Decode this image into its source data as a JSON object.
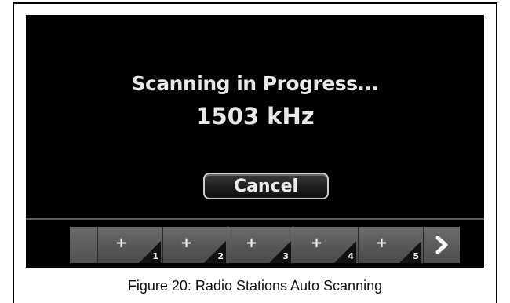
{
  "screen": {
    "title": "Scanning in Progress...",
    "frequency": "1503 kHz",
    "cancel_label": "Cancel"
  },
  "presets": [
    {
      "label": "+",
      "number": "1"
    },
    {
      "label": "+",
      "number": "2"
    },
    {
      "label": "+",
      "number": "3"
    },
    {
      "label": "+",
      "number": "4"
    },
    {
      "label": "+",
      "number": "5"
    }
  ],
  "next_icon": "chevron-right-icon",
  "caption": "Figure 20: Radio Stations Auto Scanning"
}
